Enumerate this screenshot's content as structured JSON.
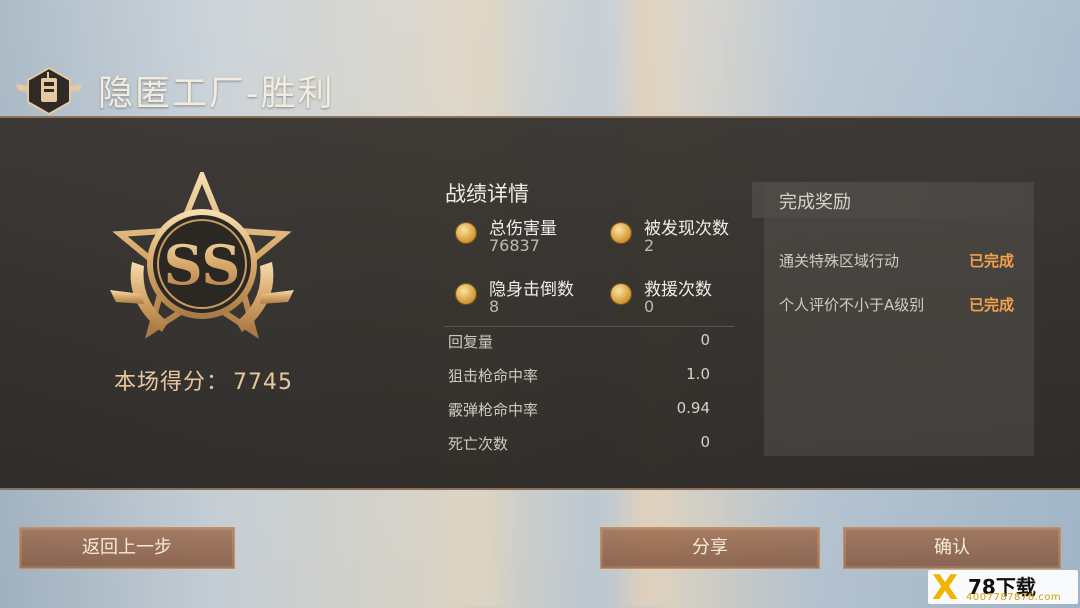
{
  "header": {
    "title": "隐匿工厂-胜利"
  },
  "rank": {
    "grade": "SS",
    "score_label": "本场得分：",
    "score_value": "7745"
  },
  "stats": {
    "title": "战绩详情",
    "main": [
      {
        "label": "总伤害量",
        "value": "76837"
      },
      {
        "label": "被发现次数",
        "value": "2"
      },
      {
        "label": "隐身击倒数",
        "value": "8"
      },
      {
        "label": "救援次数",
        "value": "0"
      }
    ],
    "rows": [
      {
        "label": "回复量",
        "value": "0"
      },
      {
        "label": "狙击枪命中率",
        "value": "1.0"
      },
      {
        "label": "霰弹枪命中率",
        "value": "0.94"
      },
      {
        "label": "死亡次数",
        "value": "0"
      }
    ]
  },
  "rewards": {
    "title": "完成奖励",
    "items": [
      {
        "label": "通关特殊区域行动",
        "status": "已完成"
      },
      {
        "label": "个人评价不小于A级别",
        "status": "已完成"
      }
    ]
  },
  "buttons": {
    "back": "返回上一步",
    "share": "分享",
    "confirm": "确认"
  },
  "watermark": {
    "logo": "X",
    "text": "78下载",
    "url": "4007787878.com"
  },
  "colors": {
    "accent": "#c98e5a",
    "complete": "#f2a24a",
    "gold": "#e9c79d"
  }
}
